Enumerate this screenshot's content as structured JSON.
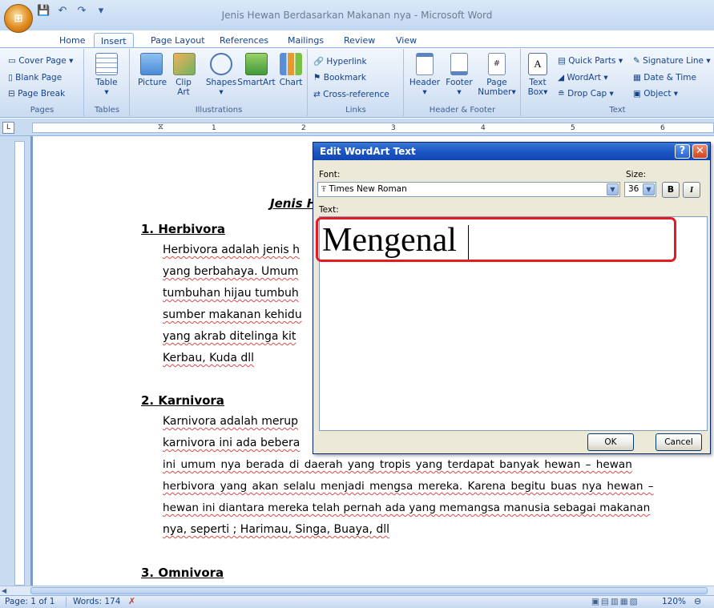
{
  "window": {
    "title": "Jenis Hewan Berdasarkan Makanan nya - Microsoft Word"
  },
  "tabs": [
    "Home",
    "Insert",
    "Page Layout",
    "References",
    "Mailings",
    "Review",
    "View"
  ],
  "active_tab": "Insert",
  "ribbon": {
    "pages": {
      "items": [
        "Cover Page",
        "Blank Page",
        "Page Break"
      ],
      "label": "Pages"
    },
    "tables": {
      "button": "Table",
      "label": "Tables"
    },
    "illustrations": {
      "buttons": [
        "Picture",
        "Clip Art",
        "Shapes",
        "SmartArt",
        "Chart"
      ],
      "clip_line2": "Art",
      "clip_line1": "Clip",
      "label": "Illustrations"
    },
    "links": {
      "items": [
        "Hyperlink",
        "Bookmark",
        "Cross-reference"
      ],
      "label": "Links"
    },
    "header_footer": {
      "buttons": [
        "Header",
        "Footer",
        "Page"
      ],
      "page_line2": "Number",
      "label": "Header & Footer"
    },
    "text": {
      "textbox_line1": "Text",
      "textbox_line2": "Box",
      "items": [
        "Quick Parts",
        "WordArt",
        "Drop Cap"
      ],
      "items2": [
        "Signature Line",
        "Date & Time",
        "Object"
      ],
      "label": "Text"
    }
  },
  "ruler": {
    "numbers": [
      "1",
      "2",
      "3",
      "4",
      "5",
      "6"
    ]
  },
  "document": {
    "title_partial": "Jenis H",
    "sections": [
      {
        "heading": "1. Herbivora",
        "lines": [
          "Herbivora adalah jenis h",
          "yang berbahaya. Umum",
          "tumbuhan hijau tumbuh",
          "sumber makanan kehidu",
          "yang akrab ditelinga kit",
          "Kerbau, Kuda dll"
        ]
      },
      {
        "heading": "2. Karnivora",
        "lines": [
          "Karnivora adalah merup",
          "karnivora ini ada bebera",
          "ini umum nya berada di daerah yang tropis yang terdapat banyak hewan – hewan",
          "herbivora yang akan selalu menjadi mengsa mereka. Karena begitu buas nya hewan –",
          "hewan ini diantara mereka telah pernah ada yang memangsa manusia sebagai makanan",
          "nya, seperti ; Harimau, Singa, Buaya, dll"
        ]
      },
      {
        "heading": "3. Omnivora",
        "lines": []
      }
    ]
  },
  "dialog": {
    "title": "Edit WordArt Text",
    "font_label": "Font:",
    "font_value": "Times New Roman",
    "size_label": "Size:",
    "size_value": "36",
    "bold_label": "B",
    "italic_label": "I",
    "text_label": "Text:",
    "text_value": "Mengenal",
    "ok_label": "OK",
    "cancel_label": "Cancel"
  },
  "statusbar": {
    "page": "Page: 1 of 1",
    "words": "Words: 174",
    "zoom": "120%"
  },
  "colors": {
    "highlight": "#e51b24",
    "dialog_title": "#1c57c4"
  }
}
